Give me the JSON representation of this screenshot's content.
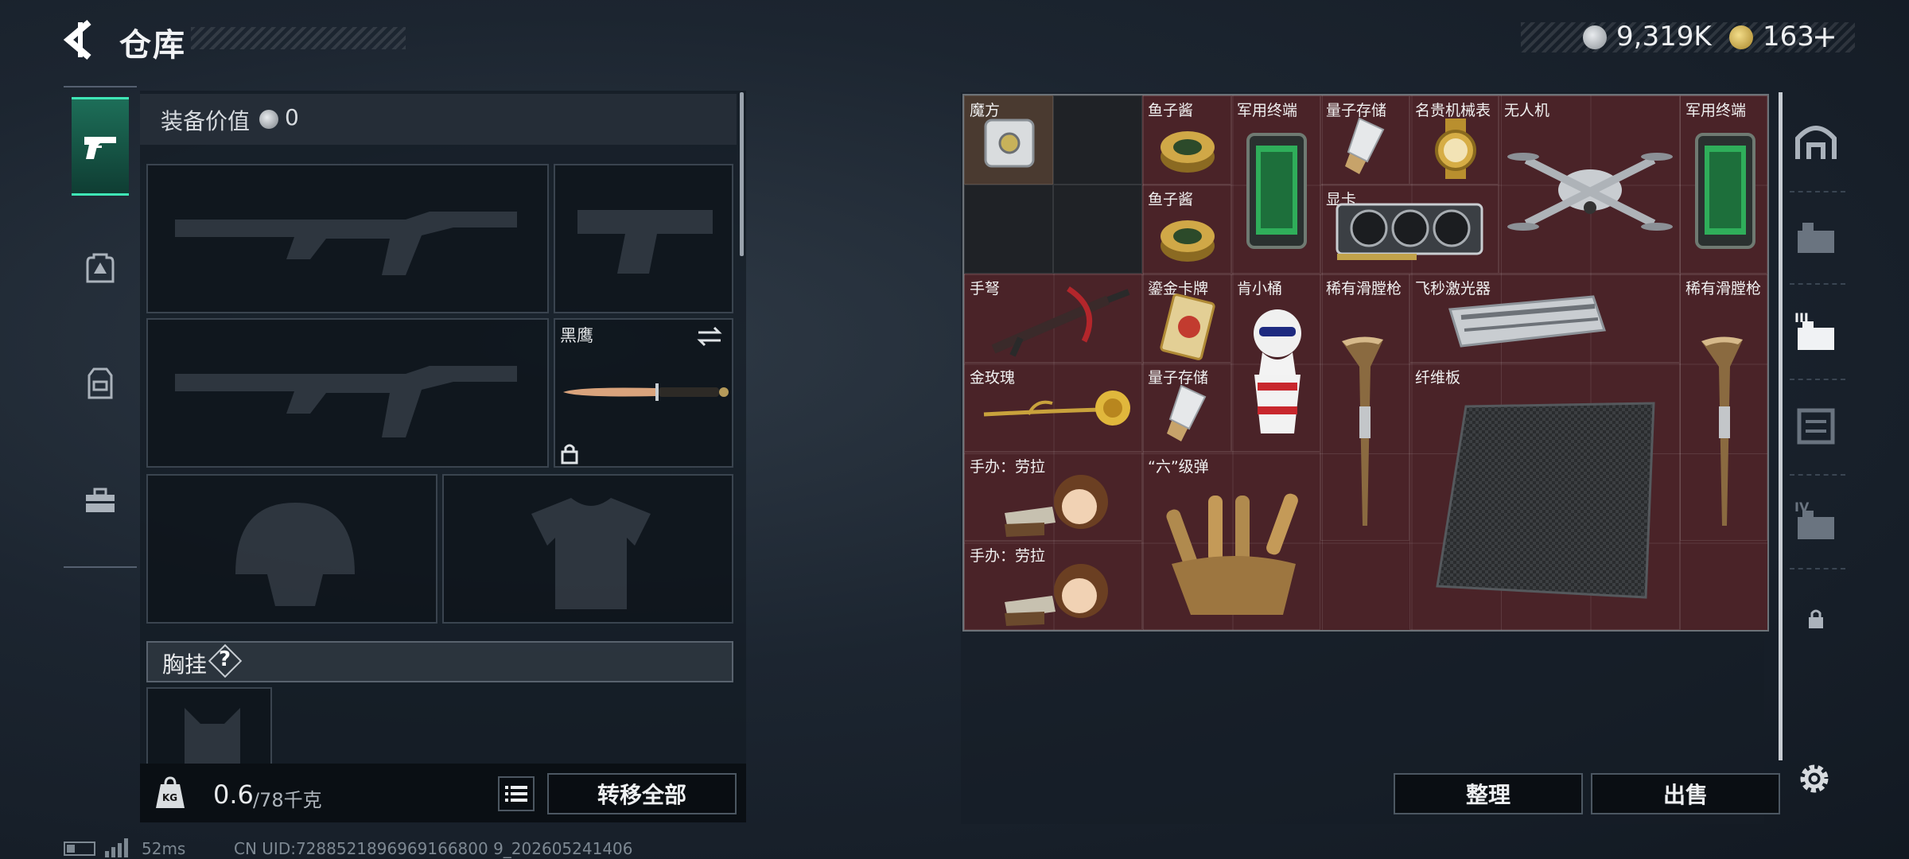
{
  "header": {
    "title": "仓库",
    "silver_amount": "9,319K",
    "gold_amount": "163",
    "gold_plus": "+"
  },
  "colors": {
    "accent": "#3fe6b6",
    "stash_bg": "#4a2328",
    "panel_bg": "#141c24"
  },
  "left_tabs": [
    {
      "icon": "pistol-icon",
      "active": true
    },
    {
      "icon": "backpack-icon",
      "active": false
    },
    {
      "icon": "vest-icon",
      "active": false
    },
    {
      "icon": "toolbox-icon",
      "active": false
    }
  ],
  "equipment": {
    "value_label": "装备价值",
    "value": "0",
    "melee_name": "黑鹰",
    "chest_rig_label": "胸挂",
    "help": "?"
  },
  "weight": {
    "current": "0.6",
    "max": "/78千克",
    "weight_icon_text": "KG"
  },
  "buttons": {
    "transfer_all": "转移全部",
    "organize": "整理",
    "sell": "出售"
  },
  "stash_items": [
    {
      "name": "魔方"
    },
    {
      "name": "鱼子酱"
    },
    {
      "name": "军用终端"
    },
    {
      "name": "量子存储"
    },
    {
      "name": "名贵机械表"
    },
    {
      "name": "无人机"
    },
    {
      "name": "军用终端"
    },
    {
      "name": "鱼子酱"
    },
    {
      "name": "显卡"
    },
    {
      "name": "手弩"
    },
    {
      "name": "鎏金卡牌"
    },
    {
      "name": "肯小桶"
    },
    {
      "name": "稀有滑膛枪"
    },
    {
      "name": "飞秒激光器"
    },
    {
      "name": "稀有滑膛枪"
    },
    {
      "name": "金玫瑰"
    },
    {
      "name": "量子存储"
    },
    {
      "name": "纤维板"
    },
    {
      "name": "手办：劳拉"
    },
    {
      "name": "“六”级弹"
    },
    {
      "name": "手办：劳拉"
    }
  ],
  "right_tabs": [
    {
      "icon": "home-icon"
    },
    {
      "icon": "crate-icon"
    },
    {
      "icon": "crate-selected-icon",
      "label": "III"
    },
    {
      "icon": "cabinet-icon"
    },
    {
      "icon": "crate-four-icon",
      "label": "IV"
    },
    {
      "icon": "lock-icon"
    }
  ],
  "status": {
    "ping": "52ms",
    "uid": "CN UID:7288521896969166800 9_202605241406"
  }
}
